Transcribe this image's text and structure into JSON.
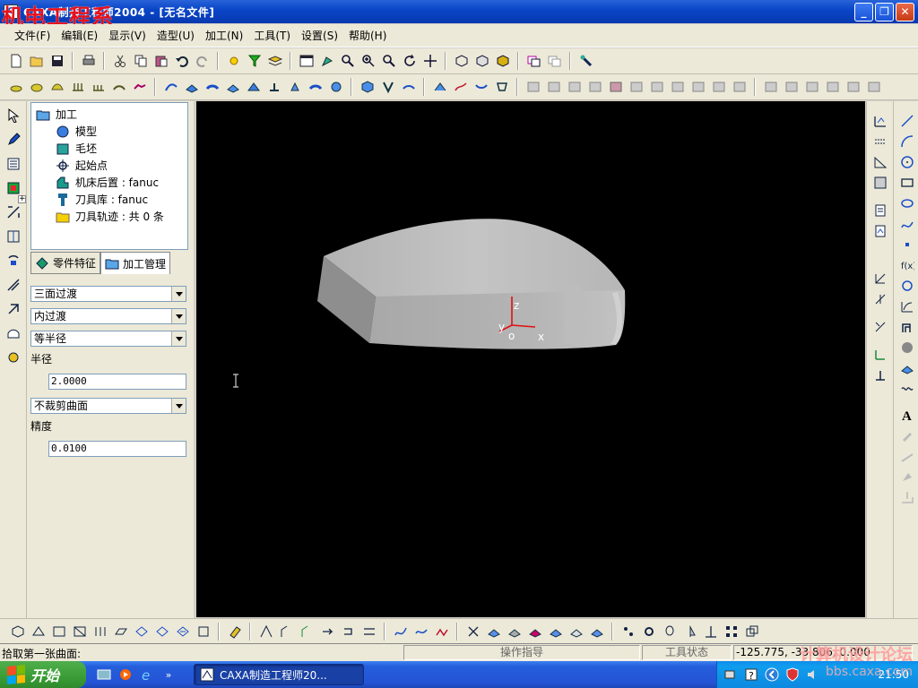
{
  "window": {
    "title": "CAXA制造工程师2004 - [无名文件]",
    "watermark": "机电工程系",
    "minimize_label": "_",
    "restore_label": "❐",
    "close_label": "✕"
  },
  "menu": [
    "文件(F)",
    "编辑(E)",
    "显示(V)",
    "造型(U)",
    "加工(N)",
    "工具(T)",
    "设置(S)",
    "帮助(H)"
  ],
  "tree": {
    "root": "加工",
    "items": [
      "模型",
      "毛坯",
      "起始点",
      "机床后置 : fanuc",
      "刀具库 : fanuc",
      "刀具轨迹 : 共 0 条"
    ],
    "expand_symbol": "+"
  },
  "tabs": [
    "零件特征",
    "加工管理"
  ],
  "form": {
    "transition_type": "三面过渡",
    "transition_mode": "内过渡",
    "radius_mode": "等半径",
    "radius_label": "半径",
    "radius_value": "2.0000",
    "trim_mode": "不裁剪曲面",
    "precision_label": "精度",
    "precision_value": "0.0100"
  },
  "axes": {
    "z": "z",
    "y": "y",
    "o": "o",
    "x": "x"
  },
  "status": {
    "prompt": "拾取第一张曲面:",
    "guide": "操作指导",
    "tool_state": "工具状态",
    "coords": "-125.775, -33.806, 0.000"
  },
  "taskbar": {
    "start": "开始",
    "task": "CAXA制造工程师20...",
    "clock": "21:50",
    "overflow": "»"
  },
  "forum_watermark": "计算机设计论坛",
  "site_watermark": "bbs.caxa.com",
  "colors": {
    "title_blue": "#0a46c8",
    "workspace": "#000000",
    "model_gray": "#b8b8b8",
    "axis_red": "#e01010"
  }
}
